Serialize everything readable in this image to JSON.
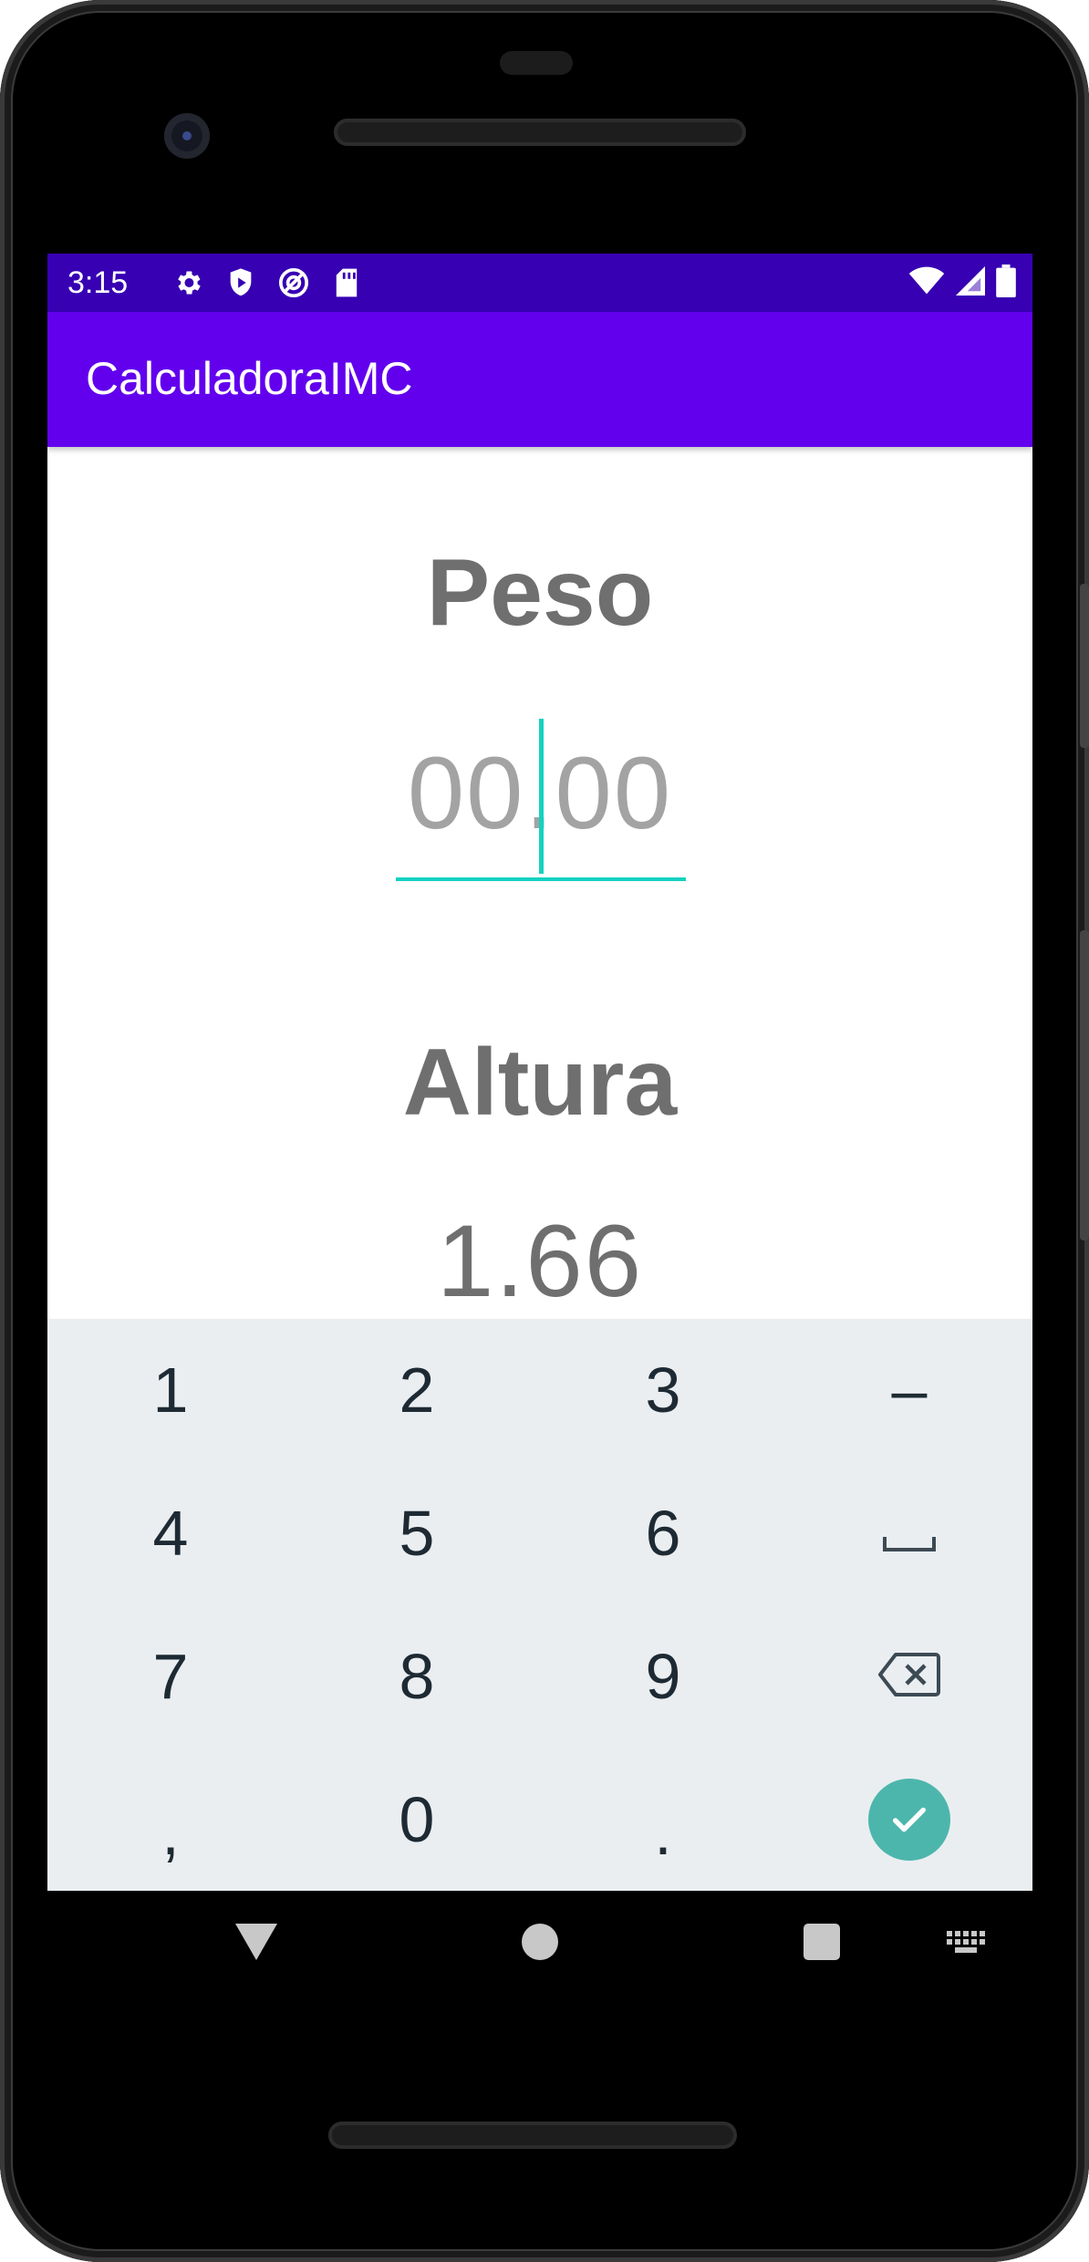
{
  "status_bar": {
    "time": "3:15",
    "left_icons": [
      "settings-icon",
      "shield-icon",
      "vpn-icon",
      "sd-card-icon"
    ],
    "right_icons": [
      "wifi-icon",
      "signal-icon",
      "battery-icon"
    ]
  },
  "app_bar": {
    "title": "CalculadoraIMC"
  },
  "form": {
    "peso_label": "Peso",
    "peso_value": "",
    "peso_placeholder": "00.00",
    "altura_label": "Altura",
    "altura_value": "1.66"
  },
  "keyboard": {
    "rows": [
      [
        "1",
        "2",
        "3",
        "–"
      ],
      [
        "4",
        "5",
        "6",
        "space"
      ],
      [
        "7",
        "8",
        "9",
        "backspace"
      ],
      [
        ",",
        "0",
        ".",
        "enter"
      ]
    ]
  },
  "colors": {
    "status_bar": "#3700b3",
    "app_bar": "#6200ee",
    "accent": "#14d2c2",
    "label": "#6f6f6f",
    "keyboard_bg": "#eaeef1",
    "enter_key": "#4db6ac"
  },
  "nav_bar": {
    "buttons": [
      "back-icon",
      "home-icon",
      "recents-icon",
      "keyboard-switch-icon"
    ]
  }
}
